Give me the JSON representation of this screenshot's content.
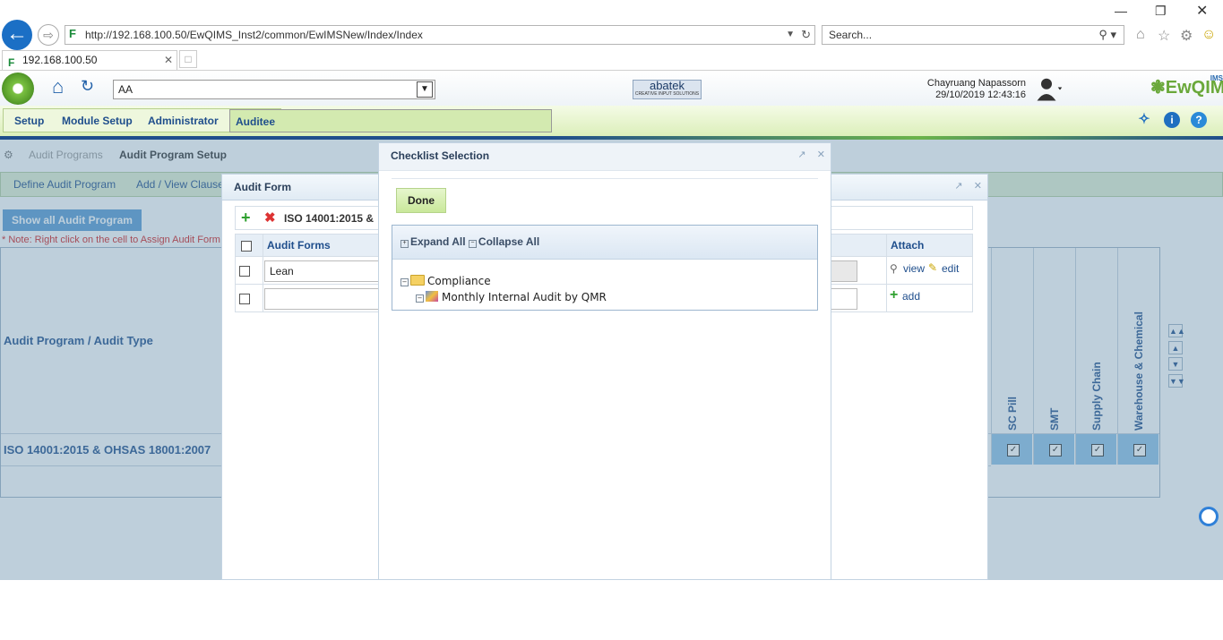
{
  "browser": {
    "url": "http://192.168.100.50/EwQIMS_Inst2/common/EwIMSNew/Index/Index",
    "search_placeholder": "Search...",
    "tab_title": "192.168.100.50"
  },
  "app": {
    "site_select": "AA",
    "brand": "abatek",
    "brand_tagline": "CREATIVE INPUT SOLUTIONS",
    "user_name": "Chayruang Napassorn",
    "datetime": "29/10/2019 12:43:16",
    "product_logo": "EwQIMS",
    "product_logo_sup": "IMS",
    "menu": [
      "Setup",
      "Module Setup",
      "Administrator",
      "Auditee"
    ]
  },
  "page": {
    "breadcrumb": [
      "Audit Programs",
      "Audit Program Setup"
    ],
    "tabs": [
      "Define Audit Program",
      "Add / View Clause"
    ],
    "show_all_button": "Show all Audit Program",
    "note": "* Note: Right click on the cell to Assign Audit Form",
    "row_header": "Audit Program / Audit Type",
    "row_value": "ISO 14001:2015 & OHSAS 18001:2007",
    "columns": [
      "SC Pill",
      "SMT",
      "Supply Chain",
      "Warehouse & Chemical"
    ]
  },
  "audit_form": {
    "title": "Audit Form",
    "toolbar_title": "ISO 14001:2015 &",
    "col_forms": "Audit Forms",
    "col_attach": "Attach",
    "row1_value": "Lean",
    "view_label": "view",
    "edit_label": "edit",
    "add_label": "add"
  },
  "checklist": {
    "title": "Checklist Selection",
    "done_label": "Done",
    "expand_all": "Expand All",
    "collapse_all": "Collapse All",
    "tree": {
      "root": "Compliance",
      "child": "Monthly Internal Audit by QMR"
    }
  }
}
